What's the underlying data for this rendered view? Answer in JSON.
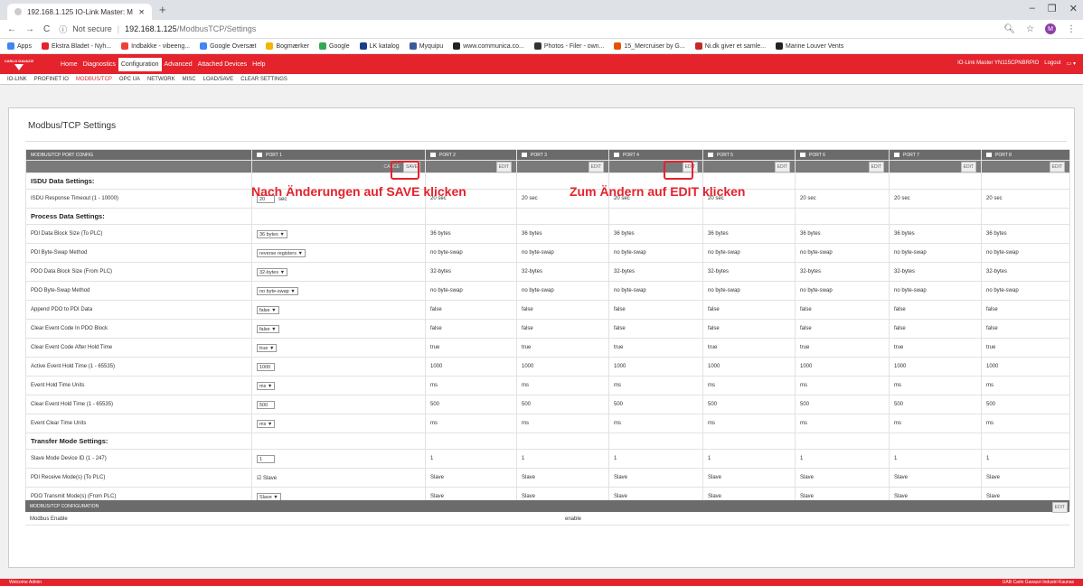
{
  "browser": {
    "tab_title": "192.168.1.125 IO-Link Master: M",
    "url_prefix": "Not secure",
    "url_host": "192.168.1.125",
    "url_path": "/ModbusTCP/Settings",
    "avatar_letter": "M",
    "bookmarks": [
      {
        "label": "Apps",
        "color": "#4285f4"
      },
      {
        "label": "Ekstra Bladet - Nyh...",
        "color": "#e4232d"
      },
      {
        "label": "Indbakke - vibeeng...",
        "color": "#ea4335"
      },
      {
        "label": "Google Oversæt",
        "color": "#4285f4"
      },
      {
        "label": "Bogmærker",
        "color": "#f4b400"
      },
      {
        "label": "Google",
        "color": "#34a853"
      },
      {
        "label": "LK katalog",
        "color": "#1a3d8f"
      },
      {
        "label": "Myquipu",
        "color": "#3b5998"
      },
      {
        "label": "www.communica.co...",
        "color": "#222222"
      },
      {
        "label": "Photos - Filer - own...",
        "color": "#333333"
      },
      {
        "label": "15_Mercruiser by G...",
        "color": "#e65100"
      },
      {
        "label": "Ni.dk giver et samle...",
        "color": "#c62828"
      },
      {
        "label": "Marine Louver Vents",
        "color": "#222222"
      }
    ]
  },
  "app": {
    "logo_text": "CARLO GAVAZZI",
    "nav": [
      "Home",
      "Diagnostics",
      "Configuration",
      "Advanced",
      "Attached Devices",
      "Help"
    ],
    "active_nav": "Configuration",
    "device_name": "IO-Link Master YN115CPNBRPIO",
    "logout": "Logout",
    "subnav": [
      "IO-LINK",
      "PROFINET IO",
      "MODBUS/TCP",
      "OPC UA",
      "NETWORK",
      "MISC",
      "LOAD/SAVE",
      "CLEAR SETTINGS"
    ],
    "active_subnav": "MODBUS/TCP"
  },
  "page": {
    "title": "Modbus/TCP Settings",
    "table_header": "MODBUS/TCP PORT CONFIG",
    "ports": [
      "PORT 1",
      "PORT 2",
      "PORT 3",
      "PORT 4",
      "PORT 5",
      "PORT 6",
      "PORT 7",
      "PORT 8"
    ],
    "cancel_label": "CANCE",
    "save_label": "SAVE",
    "edit_label": "EDIT",
    "annotation_save": "Nach Änderungen auf SAVE klicken",
    "annotation_edit": "Zum Ändern auf EDIT klicken",
    "sections": {
      "isdu": "ISDU Data Settings:",
      "process": "Process Data Settings:",
      "transfer": "Transfer Mode Settings:"
    },
    "rows": [
      {
        "label": "ISDU Response Timeout (1 - 10000)",
        "p1": "20",
        "p1_unit": "sec",
        "p1_kind": "input",
        "others": "20 sec"
      },
      {
        "label": "PDI Data Block Size (To PLC)",
        "p1": "36 bytes ▼",
        "p1_kind": "select",
        "others": "36 bytes"
      },
      {
        "label": "PDI Byte-Swap Method",
        "p1": "reverse registers          ▼",
        "p1_kind": "select",
        "others": "no byte-swap"
      },
      {
        "label": "PDO Data Block Size (From PLC)",
        "p1": "32-bytes ▼",
        "p1_kind": "select",
        "others": "32-bytes"
      },
      {
        "label": "PDO Byte-Swap Method",
        "p1": "no byte-swap               ▼",
        "p1_kind": "select",
        "others": "no byte-swap"
      },
      {
        "label": "Append PDO to PDI Data",
        "p1": "false ▼",
        "p1_kind": "select",
        "others": "false"
      },
      {
        "label": "Clear Event Code In PDO Block",
        "p1": "false ▼",
        "p1_kind": "select",
        "others": "false"
      },
      {
        "label": "Clear Event Code After Hold Time",
        "p1": "true  ▼",
        "p1_kind": "select",
        "others": "true"
      },
      {
        "label": "Active Event Hold Time (1 - 65535)",
        "p1": "1000",
        "p1_kind": "input",
        "others": "1000"
      },
      {
        "label": "Event Hold Time Units",
        "p1": "ms    ▼",
        "p1_kind": "select",
        "others": "ms"
      },
      {
        "label": "Clear Event Hold Time (1 - 65535)",
        "p1": "500",
        "p1_kind": "input",
        "others": "500"
      },
      {
        "label": "Event Clear Time Units",
        "p1": "ms    ▼",
        "p1_kind": "select",
        "others": "ms"
      },
      {
        "label": "Slave Mode Device ID (1 - 247)",
        "p1": "1",
        "p1_kind": "input",
        "others": "1"
      },
      {
        "label": "PDI Receive Mode(s) (To PLC)",
        "p1": "☑ Slave",
        "p1_kind": "check",
        "others": "Slave"
      },
      {
        "label": "PDO Transmit Mode(s) (From PLC)",
        "p1": "Slave    ▼",
        "p1_kind": "select",
        "others": "Slave"
      }
    ],
    "modbus_header": "MODBUS/TCP CONFIGURATION",
    "modbus_enable_label": "Modbus Enable",
    "modbus_enable_value": "enable"
  },
  "footer": {
    "left": "Welcome Admin",
    "right": "UAB Carlo Gavazzi Industri Kaunas"
  }
}
